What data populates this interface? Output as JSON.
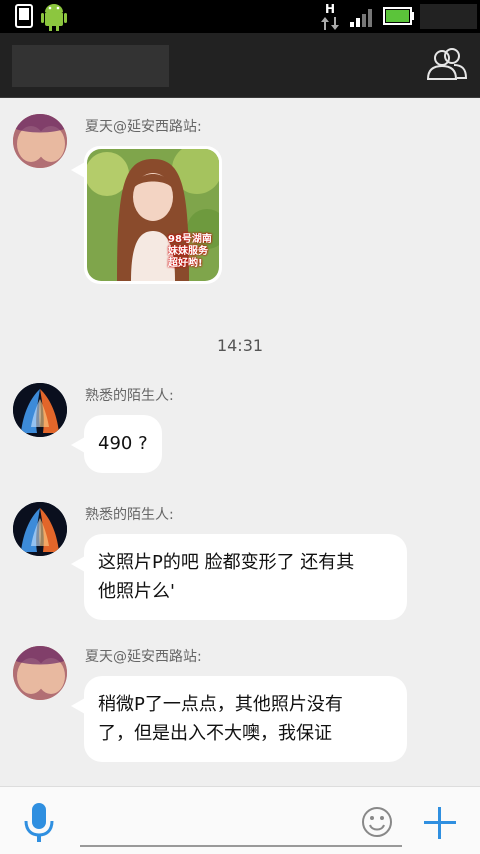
{
  "status_bar": {
    "network_type": "H",
    "icons": [
      "phone-icon",
      "android-icon",
      "data-arrows-icon",
      "signal-icon",
      "battery-icon"
    ]
  },
  "app_bar": {
    "contacts_icon": "contacts-icon"
  },
  "messages": [
    {
      "sender": "夏天@延安西路站:",
      "type": "image",
      "image_caption": [
        "98号湖南",
        "妹妹服务",
        "超好哟!"
      ]
    },
    {
      "sender": "熟悉的陌生人:",
      "type": "text",
      "text": "490 ?"
    },
    {
      "sender": "熟悉的陌生人:",
      "type": "text",
      "text_lines": [
        "这照片P的吧 脸都变形了 还有其",
        "他照片么'"
      ]
    },
    {
      "sender": "夏天@延安西路站:",
      "type": "text",
      "text_lines": [
        "稍微P了一点点，其他照片没有",
        "了，但是出入不大噢，我保证"
      ]
    }
  ],
  "timestamp": "14:31",
  "input_bar": {
    "placeholder": "",
    "mic_icon": "microphone-icon",
    "emoji_icon": "emoji-icon",
    "plus_icon": "plus-icon"
  },
  "colors": {
    "accent": "#2f8fe0",
    "battery": "#5bc43a"
  }
}
